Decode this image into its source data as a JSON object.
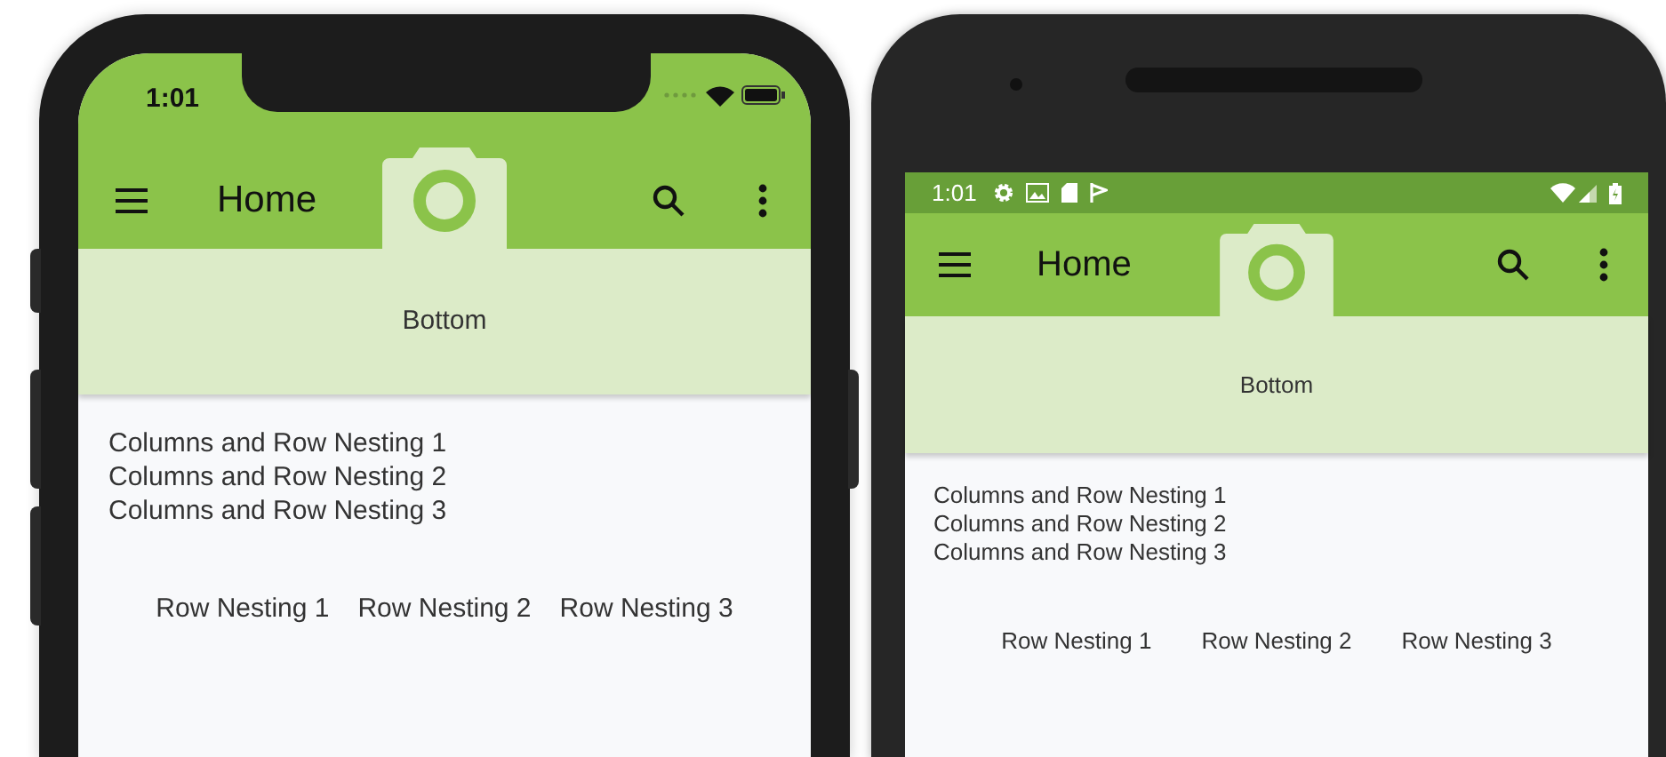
{
  "phones": [
    {
      "kind": "ios",
      "status_time": "1:01",
      "title": "Home",
      "bottom_label": "Bottom",
      "column_texts": [
        "Columns and Row Nesting 1",
        "Columns and Row Nesting 2",
        "Columns and Row Nesting 3"
      ],
      "row_texts": [
        "Row Nesting 1",
        "Row Nesting 2",
        "Row Nesting 3"
      ]
    },
    {
      "kind": "android",
      "status_time": "1:01",
      "title": "Home",
      "bottom_label": "Bottom",
      "column_texts": [
        "Columns and Row Nesting 1",
        "Columns and Row Nesting 2",
        "Columns and Row Nesting 3"
      ],
      "row_texts": [
        "Row Nesting 1",
        "Row Nesting 2",
        "Row Nesting 3"
      ]
    }
  ]
}
